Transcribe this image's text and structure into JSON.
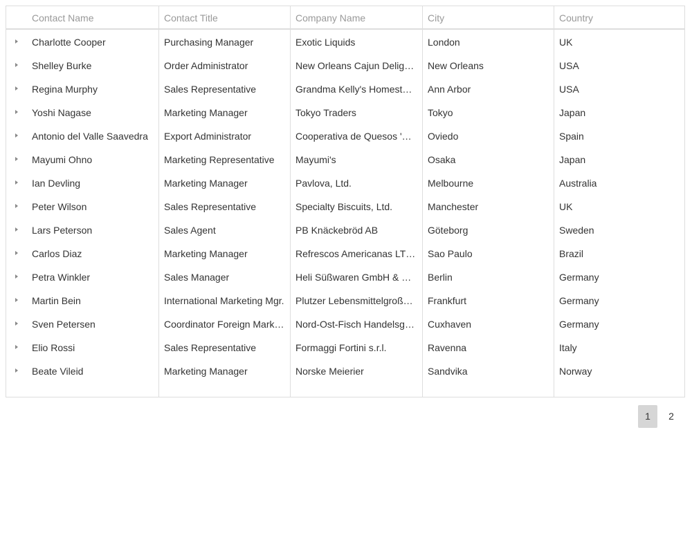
{
  "table": {
    "columns": [
      "Contact Name",
      "Contact Title",
      "Company Name",
      "City",
      "Country"
    ],
    "rows": [
      {
        "name": "Charlotte Cooper",
        "title": "Purchasing Manager",
        "company": "Exotic Liquids",
        "city": "London",
        "country": "UK"
      },
      {
        "name": "Shelley Burke",
        "title": "Order Administrator",
        "company": "New Orleans Cajun Delights",
        "city": "New Orleans",
        "country": "USA"
      },
      {
        "name": "Regina Murphy",
        "title": "Sales Representative",
        "company": "Grandma Kelly's Homestead",
        "city": "Ann Arbor",
        "country": "USA"
      },
      {
        "name": "Yoshi Nagase",
        "title": "Marketing Manager",
        "company": "Tokyo Traders",
        "city": "Tokyo",
        "country": "Japan"
      },
      {
        "name": "Antonio del Valle Saavedra",
        "title": "Export Administrator",
        "company": "Cooperativa de Quesos 'Las Cabras'",
        "city": "Oviedo",
        "country": "Spain"
      },
      {
        "name": "Mayumi Ohno",
        "title": "Marketing Representative",
        "company": "Mayumi's",
        "city": "Osaka",
        "country": "Japan"
      },
      {
        "name": "Ian Devling",
        "title": "Marketing Manager",
        "company": "Pavlova, Ltd.",
        "city": "Melbourne",
        "country": "Australia"
      },
      {
        "name": "Peter Wilson",
        "title": "Sales Representative",
        "company": "Specialty Biscuits, Ltd.",
        "city": "Manchester",
        "country": "UK"
      },
      {
        "name": "Lars Peterson",
        "title": "Sales Agent",
        "company": "PB Knäckebröd AB",
        "city": "Göteborg",
        "country": "Sweden"
      },
      {
        "name": "Carlos Diaz",
        "title": "Marketing Manager",
        "company": "Refrescos Americanas LTDA",
        "city": "Sao Paulo",
        "country": "Brazil"
      },
      {
        "name": "Petra Winkler",
        "title": "Sales Manager",
        "company": "Heli Süßwaren GmbH & Co. KG",
        "city": "Berlin",
        "country": "Germany"
      },
      {
        "name": "Martin Bein",
        "title": "International Marketing Mgr.",
        "company": "Plutzer Lebensmittelgroßmärkte AG",
        "city": "Frankfurt",
        "country": "Germany"
      },
      {
        "name": "Sven Petersen",
        "title": "Coordinator Foreign Markets",
        "company": "Nord-Ost-Fisch Handelsgesellschaft mbH",
        "city": "Cuxhaven",
        "country": "Germany"
      },
      {
        "name": "Elio Rossi",
        "title": "Sales Representative",
        "company": "Formaggi Fortini s.r.l.",
        "city": "Ravenna",
        "country": "Italy"
      },
      {
        "name": "Beate Vileid",
        "title": "Marketing Manager",
        "company": "Norske Meierier",
        "city": "Sandvika",
        "country": "Norway"
      }
    ]
  },
  "pager": {
    "pages": [
      "1",
      "2"
    ],
    "current": "1"
  }
}
